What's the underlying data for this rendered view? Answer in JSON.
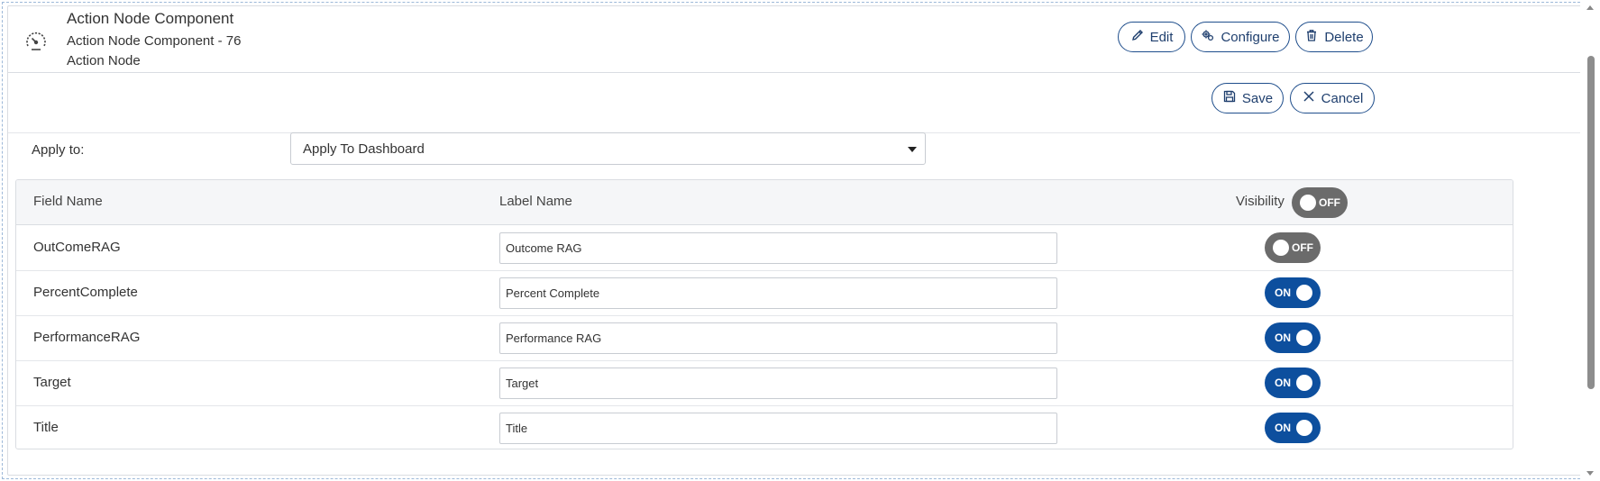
{
  "header": {
    "title": "Action Node Component",
    "subtitle": "Action Node Component - 76",
    "type_label": "Action Node",
    "icon": "gauge-icon",
    "buttons": {
      "edit": "Edit",
      "configure": "Configure",
      "delete": "Delete"
    }
  },
  "savebar": {
    "save": "Save",
    "cancel": "Cancel"
  },
  "apply_to": {
    "label": "Apply to:",
    "selected": "Apply To Dashboard"
  },
  "table": {
    "headers": {
      "field_name": "Field Name",
      "label_name": "Label Name",
      "visibility": "Visibility"
    },
    "header_toggle": {
      "state": "OFF"
    },
    "rows": [
      {
        "field": "OutComeRAG",
        "label": "Outcome RAG",
        "visibility": "OFF"
      },
      {
        "field": "PercentComplete",
        "label": "Percent Complete",
        "visibility": "ON"
      },
      {
        "field": "PerformanceRAG",
        "label": "Performance RAG",
        "visibility": "ON"
      },
      {
        "field": "Target",
        "label": "Target",
        "visibility": "ON"
      },
      {
        "field": "Title",
        "label": "Title",
        "visibility": "ON"
      }
    ]
  },
  "colors": {
    "accent": "#0d4f9e",
    "toggle_off": "#6b6b6b",
    "border": "#dadde2"
  }
}
